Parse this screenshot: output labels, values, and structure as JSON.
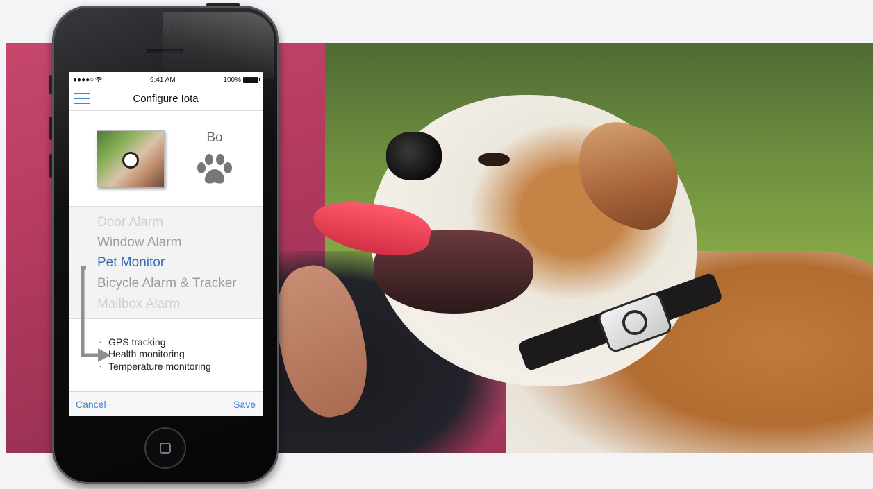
{
  "status_bar": {
    "signal": "●●●●○",
    "time": "9:41 AM",
    "battery": "100%"
  },
  "nav": {
    "title": "Configure Iota"
  },
  "profile": {
    "name": "Bo"
  },
  "picker": {
    "items": [
      "Door Alarm",
      "Window Alarm",
      "Pet Monitor",
      "Bicycle Alarm & Tracker",
      "Mailbox Alarm"
    ],
    "selected": "Pet Monitor"
  },
  "features": {
    "items": [
      "GPS tracking",
      "Health monitoring",
      "Temperature monitoring"
    ]
  },
  "toolbar": {
    "cancel_label": "Cancel",
    "save_label": "Save"
  },
  "colors": {
    "accent": "#3b86d8",
    "selected_text": "#3b6fb3"
  }
}
